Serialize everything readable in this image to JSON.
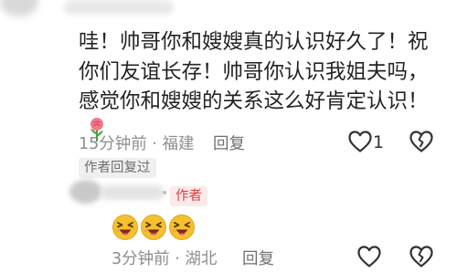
{
  "main_comment": {
    "text": "哇！帅哥你和嫂嫂真的认识好久了！祝你们友谊长存！帅哥你认识我姐夫吗，感觉你和嫂嫂的关系这么好肯定认识！",
    "time_location": "15分钟前 · 福建",
    "reply_label": "回复",
    "like_count": "1",
    "author_replied": "作者回复过"
  },
  "reply_comment": {
    "author_badge": "作者",
    "emojis": [
      "grinning-squint-emoji",
      "grinning-squint-emoji",
      "grinning-squint-emoji"
    ],
    "time_location": "3分钟前 · 湖北",
    "reply_label": "回复"
  },
  "colors": {
    "author_badge_text": "#e03a3a",
    "author_badge_bg": "#fbeaea",
    "meta_text": "#8e8e8e",
    "emoji_face": "#f5c02e"
  }
}
